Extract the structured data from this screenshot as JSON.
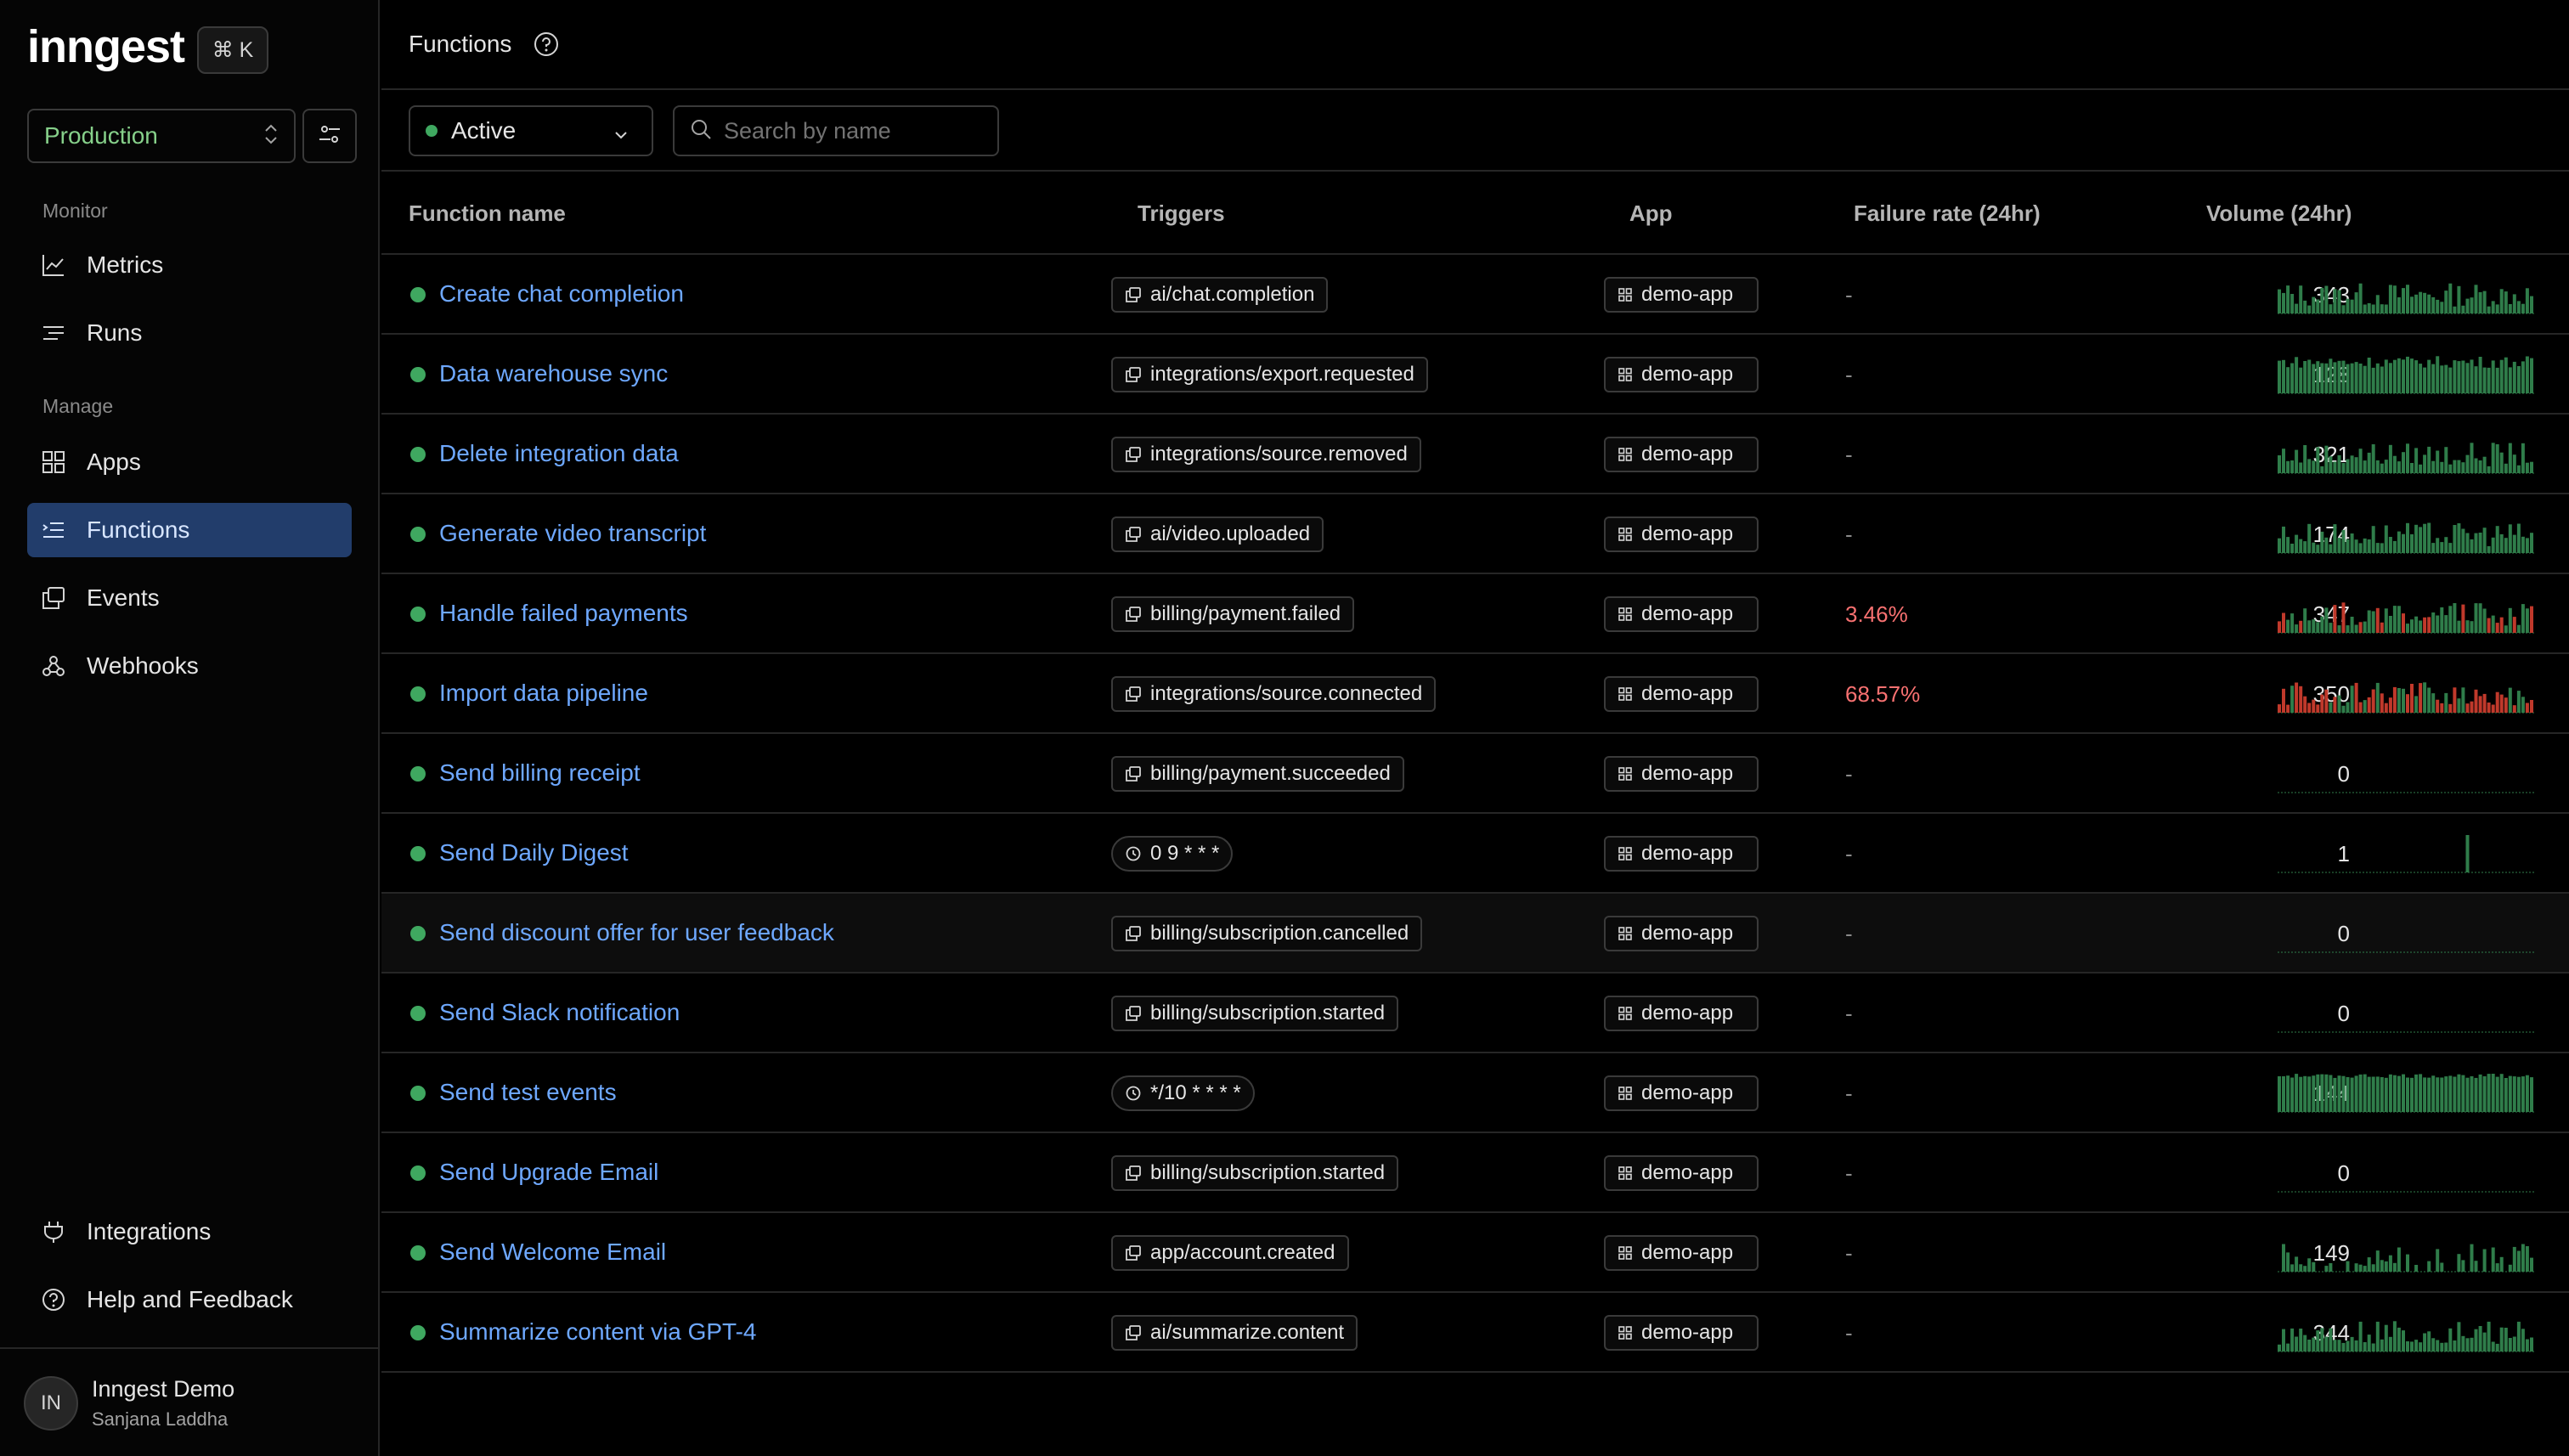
{
  "sidebar": {
    "logo": "inngest",
    "shortcut": "⌘ K",
    "environment": "Production",
    "sections": {
      "monitor": "Monitor",
      "manage": "Manage"
    },
    "items": [
      {
        "label": "Metrics",
        "icon": "chart-line-icon"
      },
      {
        "label": "Runs",
        "icon": "runs-list-icon"
      },
      {
        "label": "Apps",
        "icon": "apps-grid-icon"
      },
      {
        "label": "Functions",
        "icon": "functions-list-icon",
        "active": true
      },
      {
        "label": "Events",
        "icon": "events-icon"
      },
      {
        "label": "Webhooks",
        "icon": "webhook-icon"
      }
    ],
    "bottom_items": [
      {
        "label": "Integrations",
        "icon": "plug-icon"
      },
      {
        "label": "Help and Feedback",
        "icon": "help-circle-icon"
      }
    ],
    "user": {
      "initials": "IN",
      "name": "Inngest Demo",
      "subtitle": "Sanjana Laddha"
    }
  },
  "header": {
    "title": "Functions"
  },
  "toolbar": {
    "status": "Active",
    "search_placeholder": "Search by name"
  },
  "table": {
    "columns": [
      "Function name",
      "Triggers",
      "App",
      "Failure rate (24hr)",
      "Volume (24hr)"
    ],
    "rows": [
      {
        "name": "Create chat completion",
        "trigger": "ai/chat.completion",
        "trigger_type": "event",
        "app": "demo-app",
        "failure": "-",
        "volume": "343",
        "spark": "varied"
      },
      {
        "name": "Data warehouse sync",
        "trigger": "integrations/export.requested",
        "trigger_type": "event",
        "app": "demo-app",
        "failure": "-",
        "volume": "128",
        "spark": "dense"
      },
      {
        "name": "Delete integration data",
        "trigger": "integrations/source.removed",
        "trigger_type": "event",
        "app": "demo-app",
        "failure": "-",
        "volume": "321",
        "spark": "varied"
      },
      {
        "name": "Generate video transcript",
        "trigger": "ai/video.uploaded",
        "trigger_type": "event",
        "app": "demo-app",
        "failure": "-",
        "volume": "174",
        "spark": "varied"
      },
      {
        "name": "Handle failed payments",
        "trigger": "billing/payment.failed",
        "trigger_type": "event",
        "app": "demo-app",
        "failure": "3.46%",
        "volume": "347",
        "spark": "varied-red-few"
      },
      {
        "name": "Import data pipeline",
        "trigger": "integrations/source.connected",
        "trigger_type": "event",
        "app": "demo-app",
        "failure": "68.57%",
        "volume": "350",
        "spark": "varied-red-many"
      },
      {
        "name": "Send billing receipt",
        "trigger": "billing/payment.succeeded",
        "trigger_type": "event",
        "app": "demo-app",
        "failure": "-",
        "volume": "0",
        "spark": "empty"
      },
      {
        "name": "Send Daily Digest",
        "trigger": "0 9 * * *",
        "trigger_type": "cron",
        "app": "demo-app",
        "failure": "-",
        "volume": "1",
        "spark": "single"
      },
      {
        "name": "Send discount offer for user feedback",
        "trigger": "billing/subscription.cancelled",
        "trigger_type": "event",
        "app": "demo-app",
        "failure": "-",
        "volume": "0",
        "spark": "empty"
      },
      {
        "name": "Send Slack notification",
        "trigger": "billing/subscription.started",
        "trigger_type": "event",
        "app": "demo-app",
        "failure": "-",
        "volume": "0",
        "spark": "empty"
      },
      {
        "name": "Send test events",
        "trigger": "*/10 * * * *",
        "trigger_type": "cron",
        "app": "demo-app",
        "failure": "-",
        "volume": "144",
        "spark": "full"
      },
      {
        "name": "Send Upgrade Email",
        "trigger": "billing/subscription.started",
        "trigger_type": "event",
        "app": "demo-app",
        "failure": "-",
        "volume": "0",
        "spark": "empty"
      },
      {
        "name": "Send Welcome Email",
        "trigger": "app/account.created",
        "trigger_type": "event",
        "app": "demo-app",
        "failure": "-",
        "volume": "149",
        "spark": "sparse"
      },
      {
        "name": "Summarize content via GPT-4",
        "trigger": "ai/summarize.content",
        "trigger_type": "event",
        "app": "demo-app",
        "failure": "-",
        "volume": "344",
        "spark": "varied"
      }
    ]
  },
  "colors": {
    "accent_blue": "#6ea8ff",
    "success_green": "#3fa860",
    "failure_red": "#f87171",
    "spark_green": "#2f7d4a",
    "spark_red": "#c0392b",
    "active_nav_bg": "#223d6b"
  }
}
